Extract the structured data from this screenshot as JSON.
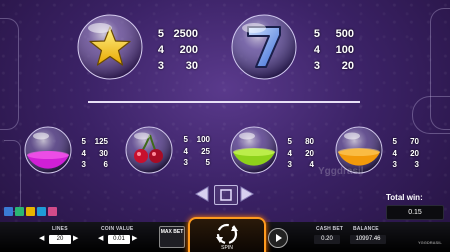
{
  "paytable": {
    "top": [
      {
        "symbol": "star-ball",
        "rows": [
          {
            "count": "5",
            "value": "2500"
          },
          {
            "count": "4",
            "value": "200"
          },
          {
            "count": "3",
            "value": "30"
          }
        ]
      },
      {
        "symbol": "seven-ball",
        "rows": [
          {
            "count": "5",
            "value": "500"
          },
          {
            "count": "4",
            "value": "100"
          },
          {
            "count": "3",
            "value": "20"
          }
        ]
      }
    ],
    "bottom": [
      {
        "symbol": "purple-potion-ball",
        "rows": [
          {
            "count": "5",
            "value": "125"
          },
          {
            "count": "4",
            "value": "30"
          },
          {
            "count": "3",
            "value": "6"
          }
        ]
      },
      {
        "symbol": "cherries-ball",
        "rows": [
          {
            "count": "5",
            "value": "100"
          },
          {
            "count": "4",
            "value": "25"
          },
          {
            "count": "3",
            "value": "5"
          }
        ]
      },
      {
        "symbol": "green-potion-ball",
        "rows": [
          {
            "count": "5",
            "value": "80"
          },
          {
            "count": "4",
            "value": "20"
          },
          {
            "count": "3",
            "value": "4"
          }
        ]
      },
      {
        "symbol": "orange-potion-ball",
        "rows": [
          {
            "count": "5",
            "value": "70"
          },
          {
            "count": "4",
            "value": "20"
          },
          {
            "count": "3",
            "value": "3"
          }
        ]
      }
    ]
  },
  "watermark": "Yggdrasil",
  "total_win": {
    "label": "Total win:",
    "value": "0.15"
  },
  "bottom_bar": {
    "lines_label": "LINES",
    "lines_value": "20",
    "coin_value_label": "COIN VALUE",
    "coin_value": "0.01",
    "max_bet_label": "MAX BET",
    "spin_label": "SPIN",
    "cash_bet_label": "CASH BET",
    "cash_bet_value": "0.20",
    "balance_label": "BALANCE",
    "balance_value": "10997.46",
    "brand": "YGGDRASIL"
  },
  "colors": {
    "background": "#3b2266",
    "accent": "#ff9a1e",
    "bar": "#000000"
  }
}
